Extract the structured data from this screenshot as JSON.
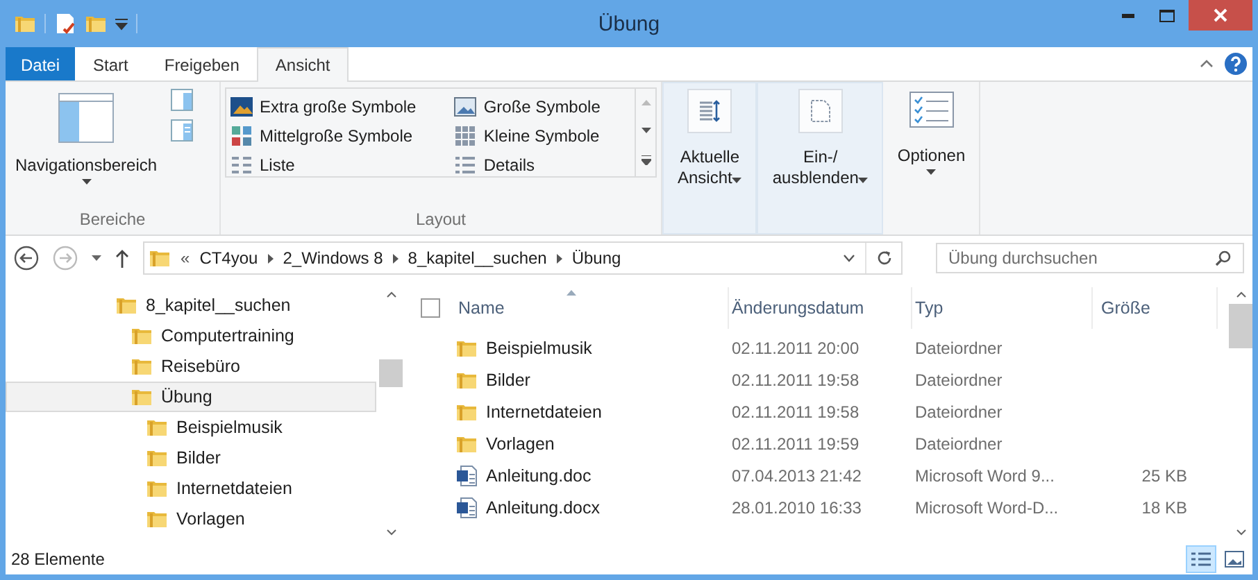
{
  "window": {
    "title": "Übung"
  },
  "ribbon_tabs": [
    {
      "label": "Datei",
      "kind": "file",
      "selected": false
    },
    {
      "label": "Start",
      "kind": "tab",
      "selected": false
    },
    {
      "label": "Freigeben",
      "kind": "tab",
      "selected": false
    },
    {
      "label": "Ansicht",
      "kind": "tab",
      "selected": true
    }
  ],
  "panes_group": {
    "label": "Bereiche",
    "navigation_button": "Navigationsbereich"
  },
  "layout_group": {
    "label": "Layout",
    "items": [
      {
        "label": "Extra große Symbole",
        "kind": "xl"
      },
      {
        "label": "Große Symbole",
        "kind": "large"
      },
      {
        "label": "Mittelgroße Symbole",
        "kind": "medium"
      },
      {
        "label": "Kleine Symbole",
        "kind": "small"
      },
      {
        "label": "Liste",
        "kind": "list"
      },
      {
        "label": "Details",
        "kind": "details"
      }
    ]
  },
  "view_buttons": [
    {
      "lines": [
        "Aktuelle",
        "Ansicht"
      ],
      "kind": "sort"
    },
    {
      "lines": [
        "Ein-/",
        "ausblenden"
      ],
      "kind": "show"
    },
    {
      "lines": [
        "Optionen"
      ],
      "kind": "options"
    }
  ],
  "address": {
    "prefix": "«",
    "crumbs": [
      "CT4you",
      "2_Windows 8",
      "8_kapitel__suchen",
      "Übung"
    ]
  },
  "search": {
    "placeholder": "Übung durchsuchen"
  },
  "tree": [
    {
      "label": "8_kapitel__suchen",
      "selected": false,
      "children": [
        {
          "label": "Computertraining",
          "selected": false
        },
        {
          "label": "Reisebüro",
          "selected": false
        },
        {
          "label": "Übung",
          "selected": true,
          "children": [
            {
              "label": "Beispielmusik",
              "selected": false
            },
            {
              "label": "Bilder",
              "selected": false
            },
            {
              "label": "Internetdateien",
              "selected": false
            },
            {
              "label": "Vorlagen",
              "selected": false
            }
          ]
        }
      ]
    }
  ],
  "select_all_checked": false,
  "columns": [
    "Name",
    "Änderungsdatum",
    "Typ",
    "Größe"
  ],
  "rows": [
    {
      "kind": "folder",
      "name": "Beispielmusik",
      "date": "02.11.2011 20:00",
      "type": "Dateiordner"
    },
    {
      "kind": "folder",
      "name": "Bilder",
      "date": "02.11.2011 19:58",
      "type": "Dateiordner"
    },
    {
      "kind": "folder",
      "name": "Internetdateien",
      "date": "02.11.2011 19:58",
      "type": "Dateiordner"
    },
    {
      "kind": "folder",
      "name": "Vorlagen",
      "date": "02.11.2011 19:59",
      "type": "Dateiordner"
    },
    {
      "kind": "word",
      "name": "Anleitung.doc",
      "date": "07.04.2013 21:42",
      "type": "Microsoft Word 9...",
      "size": "25 KB"
    },
    {
      "kind": "word",
      "name": "Anleitung.docx",
      "date": "28.01.2010 16:33",
      "type": "Microsoft Word-D...",
      "size": "18 KB"
    }
  ],
  "status_bar": {
    "count": "28 Elemente",
    "views": [
      {
        "kind": "details",
        "selected": true
      },
      {
        "kind": "large",
        "selected": false
      }
    ]
  }
}
